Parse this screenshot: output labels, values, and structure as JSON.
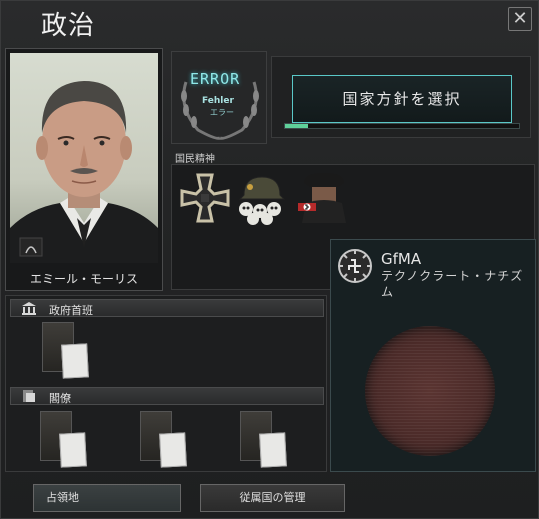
{
  "window": {
    "title": "政治",
    "close_icon": "close-icon"
  },
  "leader": {
    "name": "エミール・モーリス"
  },
  "ideology_widget": {
    "error": "ERROR",
    "fehler": "Fehler",
    "sub": "エラー"
  },
  "focus": {
    "button_label": "国家方針を選択",
    "progress": 0.1
  },
  "national_spirits": {
    "label": "国民精神",
    "items": [
      "iron-cross-icon",
      "skull-helmet-icon",
      "officer-swastika-icon"
    ]
  },
  "party": {
    "name": "GfMA",
    "ideology": "テクノクラート・ナチズム"
  },
  "government": {
    "head_label": "政府首班",
    "cabinet_label": "閣僚"
  },
  "buttons": {
    "occupied": "占領地",
    "subjects": "従属国の管理"
  },
  "colors": {
    "accent": "#5ac8c8",
    "progress": "#5fd09a",
    "party_pie": "#4a2a28"
  }
}
